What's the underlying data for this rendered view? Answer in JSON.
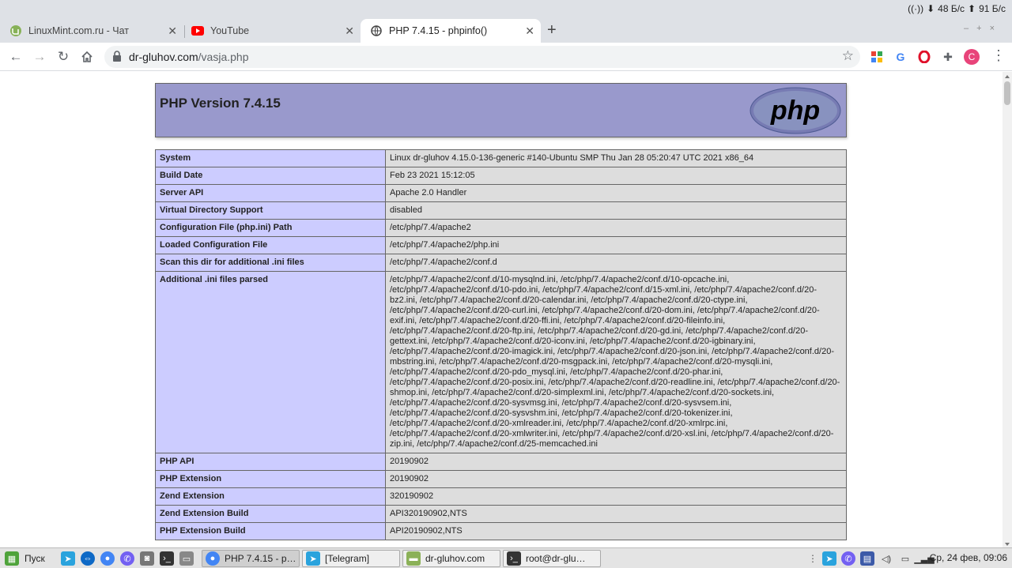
{
  "system_bar": {
    "down_speed": "48 Б/с",
    "up_speed": "91 Б/с"
  },
  "tabs": [
    {
      "label": "LinuxMint.com.ru - Чат",
      "icon": "linuxmint-icon",
      "active": false
    },
    {
      "label": "YouTube",
      "icon": "youtube-icon",
      "active": false
    },
    {
      "label": "PHP 7.4.15 - phpinfo()",
      "icon": "globe-icon",
      "active": true
    }
  ],
  "address_bar": {
    "host": "dr-gluhov.com",
    "path": "/vasja.php"
  },
  "profile": {
    "initial": "C",
    "color": "#e8447a"
  },
  "phpinfo": {
    "title": "PHP Version 7.4.15",
    "logo_text": "php",
    "rows": [
      {
        "key": "System",
        "value": "Linux dr-gluhov 4.15.0-136-generic #140-Ubuntu SMP Thu Jan 28 05:20:47 UTC 2021 x86_64"
      },
      {
        "key": "Build Date",
        "value": "Feb 23 2021 15:12:05"
      },
      {
        "key": "Server API",
        "value": "Apache 2.0 Handler"
      },
      {
        "key": "Virtual Directory Support",
        "value": "disabled"
      },
      {
        "key": "Configuration File (php.ini) Path",
        "value": "/etc/php/7.4/apache2"
      },
      {
        "key": "Loaded Configuration File",
        "value": "/etc/php/7.4/apache2/php.ini"
      },
      {
        "key": "Scan this dir for additional .ini files",
        "value": "/etc/php/7.4/apache2/conf.d"
      },
      {
        "key": "Additional .ini files parsed",
        "value": "/etc/php/7.4/apache2/conf.d/10-mysqlnd.ini, /etc/php/7.4/apache2/conf.d/10-opcache.ini, /etc/php/7.4/apache2/conf.d/10-pdo.ini, /etc/php/7.4/apache2/conf.d/15-xml.ini, /etc/php/7.4/apache2/conf.d/20-bz2.ini, /etc/php/7.4/apache2/conf.d/20-calendar.ini, /etc/php/7.4/apache2/conf.d/20-ctype.ini, /etc/php/7.4/apache2/conf.d/20-curl.ini, /etc/php/7.4/apache2/conf.d/20-dom.ini, /etc/php/7.4/apache2/conf.d/20-exif.ini, /etc/php/7.4/apache2/conf.d/20-ffi.ini, /etc/php/7.4/apache2/conf.d/20-fileinfo.ini, /etc/php/7.4/apache2/conf.d/20-ftp.ini, /etc/php/7.4/apache2/conf.d/20-gd.ini, /etc/php/7.4/apache2/conf.d/20-gettext.ini, /etc/php/7.4/apache2/conf.d/20-iconv.ini, /etc/php/7.4/apache2/conf.d/20-igbinary.ini, /etc/php/7.4/apache2/conf.d/20-imagick.ini, /etc/php/7.4/apache2/conf.d/20-json.ini, /etc/php/7.4/apache2/conf.d/20-mbstring.ini, /etc/php/7.4/apache2/conf.d/20-msgpack.ini, /etc/php/7.4/apache2/conf.d/20-mysqli.ini, /etc/php/7.4/apache2/conf.d/20-pdo_mysql.ini, /etc/php/7.4/apache2/conf.d/20-phar.ini, /etc/php/7.4/apache2/conf.d/20-posix.ini, /etc/php/7.4/apache2/conf.d/20-readline.ini, /etc/php/7.4/apache2/conf.d/20-shmop.ini, /etc/php/7.4/apache2/conf.d/20-simplexml.ini, /etc/php/7.4/apache2/conf.d/20-sockets.ini, /etc/php/7.4/apache2/conf.d/20-sysvmsg.ini, /etc/php/7.4/apache2/conf.d/20-sysvsem.ini, /etc/php/7.4/apache2/conf.d/20-sysvshm.ini, /etc/php/7.4/apache2/conf.d/20-tokenizer.ini, /etc/php/7.4/apache2/conf.d/20-xmlreader.ini, /etc/php/7.4/apache2/conf.d/20-xmlrpc.ini, /etc/php/7.4/apache2/conf.d/20-xmlwriter.ini, /etc/php/7.4/apache2/conf.d/20-xsl.ini, /etc/php/7.4/apache2/conf.d/20-zip.ini, /etc/php/7.4/apache2/conf.d/25-memcached.ini"
      },
      {
        "key": "PHP API",
        "value": "20190902"
      },
      {
        "key": "PHP Extension",
        "value": "20190902"
      },
      {
        "key": "Zend Extension",
        "value": "320190902"
      },
      {
        "key": "Zend Extension Build",
        "value": "API320190902,NTS"
      },
      {
        "key": "PHP Extension Build",
        "value": "API20190902,NTS"
      }
    ]
  },
  "taskbar": {
    "start_label": "Пуск",
    "windows": [
      {
        "label": "PHP 7.4.15 - p…",
        "icon": "chrome-icon",
        "active": true
      },
      {
        "label": "[Telegram]",
        "icon": "telegram-icon",
        "active": false
      },
      {
        "label": "dr-gluhov.com",
        "icon": "folder-icon",
        "active": false
      },
      {
        "label": "root@dr-glu…",
        "icon": "terminal-icon",
        "active": false
      }
    ],
    "clock": "Ср, 24 фев, 09:06"
  }
}
